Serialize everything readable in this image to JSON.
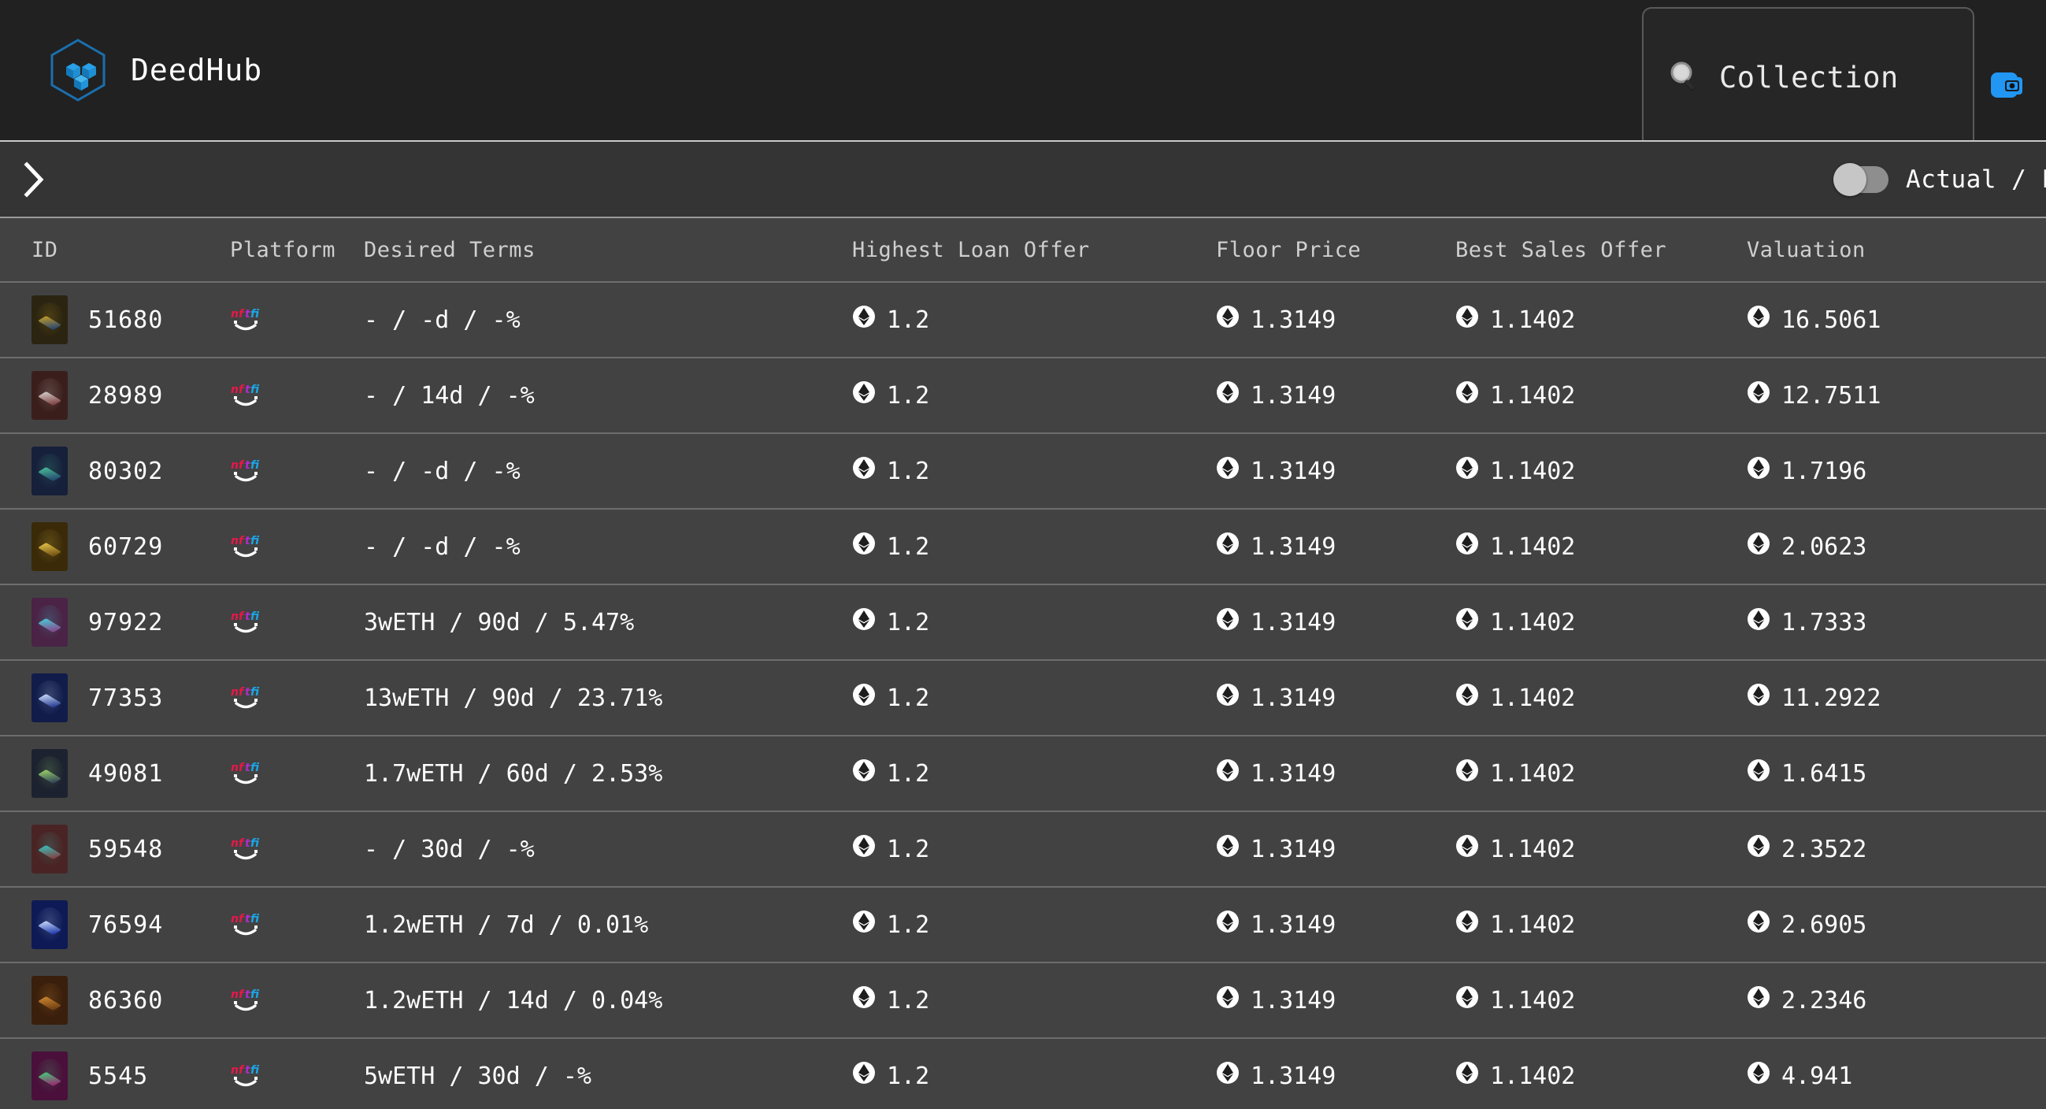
{
  "brand": {
    "name": "DeedHub",
    "logo_icon": "hexagon-cube-logo",
    "accent": "#1f8ae0"
  },
  "search": {
    "icon": "search-icon",
    "placeholder": "Collection",
    "value": ""
  },
  "wallet": {
    "icon": "wallet-icon",
    "color": "#2196f3"
  },
  "toolbar": {
    "expand_icon": "chevron-right-icon",
    "toggle": {
      "label": "Actual / LTV",
      "state": "off"
    }
  },
  "table": {
    "columns": [
      "ID",
      "Platform",
      "Desired Terms",
      "Highest Loan Offer",
      "Floor Price",
      "Best Sales Offer",
      "Valuation"
    ],
    "rows": [
      {
        "id": "51680",
        "platform": "nftfi",
        "terms": "- / -d / -%",
        "loan": "1.2",
        "floor": "1.3149",
        "sales": "1.1402",
        "valuation": "16.5061",
        "art1": "#c9a227",
        "art2": "#1c3f7a",
        "bg": "#2b2410"
      },
      {
        "id": "28989",
        "platform": "nftfi",
        "terms": "- / 14d / -%",
        "loan": "1.2",
        "floor": "1.3149",
        "sales": "1.1402",
        "valuation": "12.7511",
        "art1": "#d9d2d0",
        "art2": "#7a3a3a",
        "bg": "#3a1e1c"
      },
      {
        "id": "80302",
        "platform": "nftfi",
        "terms": "- / -d / -%",
        "loan": "1.2",
        "floor": "1.3149",
        "sales": "1.1402",
        "valuation": "1.7196",
        "art1": "#49c39a",
        "art2": "#23406e",
        "bg": "#16203a"
      },
      {
        "id": "60729",
        "platform": "nftfi",
        "terms": "- / -d / -%",
        "loan": "1.2",
        "floor": "1.3149",
        "sales": "1.1402",
        "valuation": "2.0623",
        "art1": "#e8c84a",
        "art2": "#6b4a10",
        "bg": "#3a2a08"
      },
      {
        "id": "97922",
        "platform": "nftfi",
        "terms": "3wETH / 90d / 5.47%",
        "loan": "1.2",
        "floor": "1.3149",
        "sales": "1.1402",
        "valuation": "1.7333",
        "art1": "#4ad0d8",
        "art2": "#8e3f8e",
        "bg": "#4a2346"
      },
      {
        "id": "77353",
        "platform": "nftfi",
        "terms": "13wETH / 90d / 23.71%",
        "loan": "1.2",
        "floor": "1.3149",
        "sales": "1.1402",
        "valuation": "11.2922",
        "art1": "#cfe4ff",
        "art2": "#1b2f8a",
        "bg": "#111c4a"
      },
      {
        "id": "49081",
        "platform": "nftfi",
        "terms": "1.7wETH / 60d / 2.53%",
        "loan": "1.2",
        "floor": "1.3149",
        "sales": "1.1402",
        "valuation": "1.6415",
        "art1": "#9fd86a",
        "art2": "#2a3a5a",
        "bg": "#1c2230"
      },
      {
        "id": "59548",
        "platform": "nftfi",
        "terms": "- / 30d / -%",
        "loan": "1.2",
        "floor": "1.3149",
        "sales": "1.1402",
        "valuation": "2.3522",
        "art1": "#34c6c0",
        "art2": "#8a3b3b",
        "bg": "#4a2424"
      },
      {
        "id": "76594",
        "platform": "nftfi",
        "terms": "1.2wETH / 7d / 0.01%",
        "loan": "1.2",
        "floor": "1.3149",
        "sales": "1.1402",
        "valuation": "2.6905",
        "art1": "#cfe0ff",
        "art2": "#1430a8",
        "bg": "#0d1a55"
      },
      {
        "id": "86360",
        "platform": "nftfi",
        "terms": "1.2wETH / 14d / 0.04%",
        "loan": "1.2",
        "floor": "1.3149",
        "sales": "1.1402",
        "valuation": "2.2346",
        "art1": "#d08a30",
        "art2": "#6a3a12",
        "bg": "#3a1f0c"
      },
      {
        "id": "5545",
        "platform": "nftfi",
        "terms": "5wETH / 30d / -%",
        "loan": "1.2",
        "floor": "1.3149",
        "sales": "1.1402",
        "valuation": "4.941",
        "art1": "#46d07a",
        "art2": "#a01f72",
        "bg": "#4a0f3a"
      }
    ]
  }
}
